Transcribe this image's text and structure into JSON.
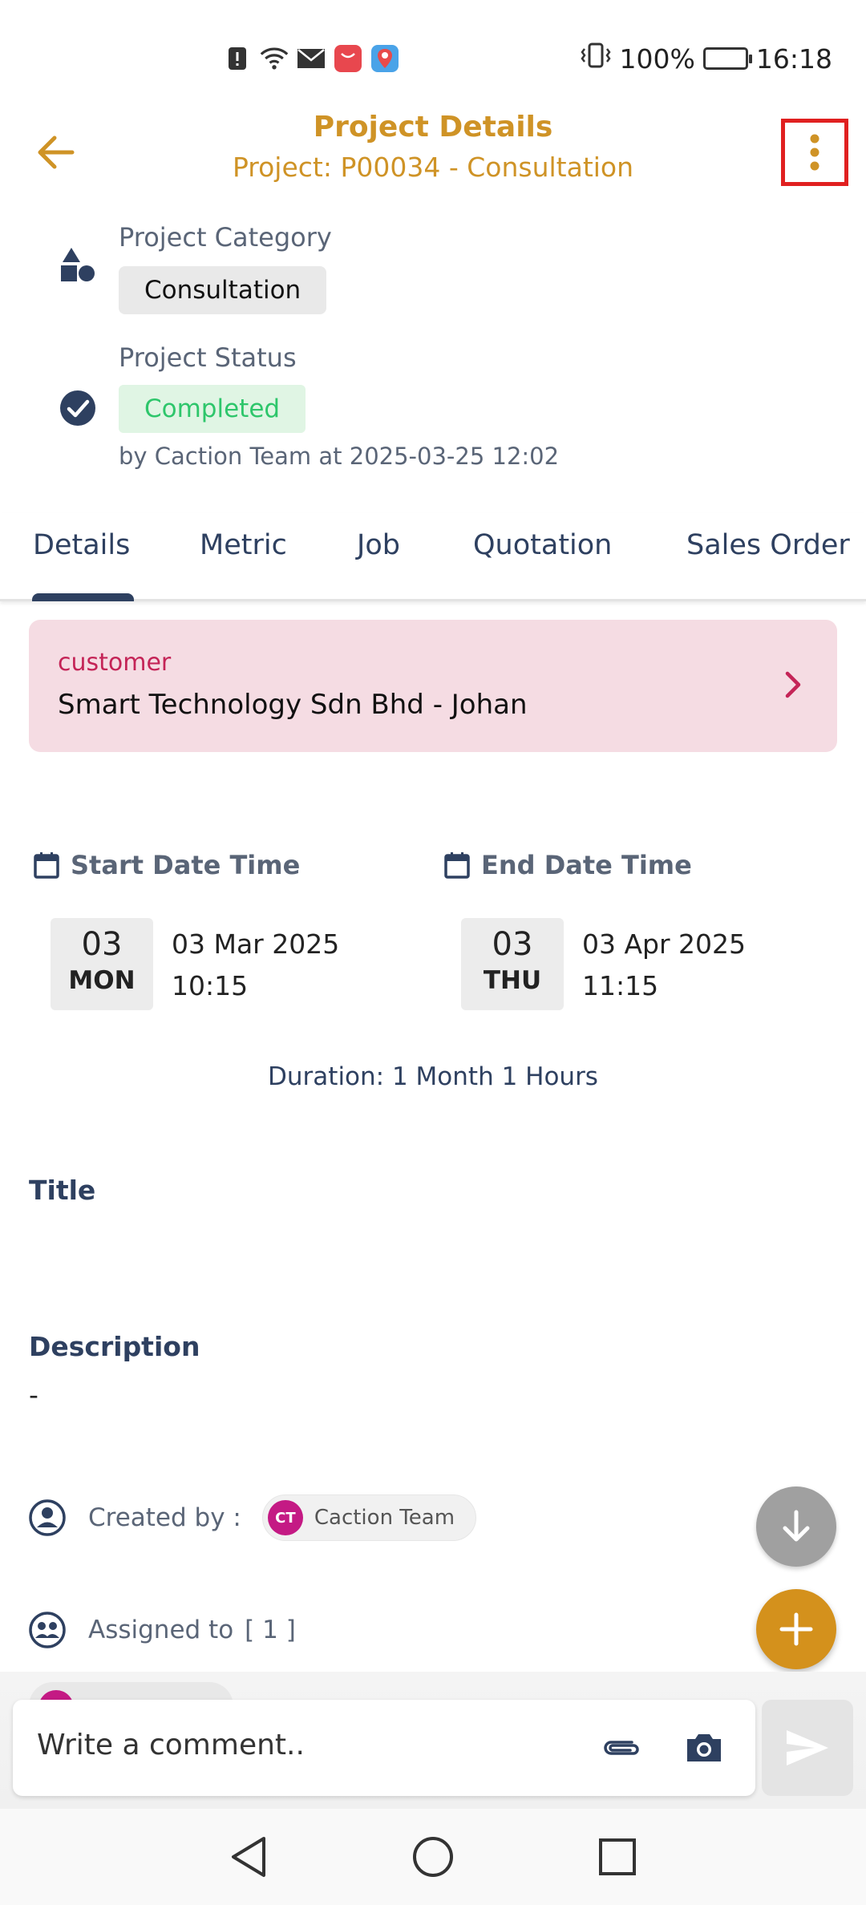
{
  "status_bar": {
    "icons": [
      "alert-icon",
      "wifi-icon",
      "mail-icon",
      "huawei-store-icon",
      "maps-icon"
    ],
    "battery": "100%",
    "time": "16:18"
  },
  "header": {
    "title": "Project Details",
    "subtitle": "Project: P00034 - Consultation"
  },
  "project": {
    "category_label": "Project Category",
    "category_value": "Consultation",
    "status_label": "Project Status",
    "status_value": "Completed",
    "status_by": "by Caction Team at 2025-03-25 12:02"
  },
  "tabs": [
    {
      "label": "Details",
      "active": true
    },
    {
      "label": "Metric",
      "active": false
    },
    {
      "label": "Job",
      "active": false
    },
    {
      "label": "Quotation",
      "active": false
    },
    {
      "label": "Sales Order",
      "active": false
    }
  ],
  "customer": {
    "label": "customer",
    "name": "Smart Technology Sdn Bhd - Johan"
  },
  "dates": {
    "start": {
      "label": "Start Date Time",
      "day": "03",
      "weekday": "MON",
      "date": "03 Mar 2025",
      "time": "10:15"
    },
    "end": {
      "label": "End Date Time",
      "day": "03",
      "weekday": "THU",
      "date": "03 Apr 2025",
      "time": "11:15"
    },
    "duration": "Duration: 1 Month 1 Hours"
  },
  "title_section": {
    "label": "Title"
  },
  "description": {
    "label": "Description",
    "value": "-"
  },
  "created_by": {
    "label": "Created by :",
    "initials": "CT",
    "name": "Caction Team"
  },
  "assigned_to": {
    "label": "Assigned to",
    "count": "[ 1 ]"
  },
  "comment": {
    "placeholder": "Write a comment.."
  },
  "colors": {
    "accent": "#cf9326",
    "navy": "#2e4060",
    "status_green": "#2ec66b",
    "customer_bg": "#f5dce3",
    "fab": "#d4911c"
  }
}
